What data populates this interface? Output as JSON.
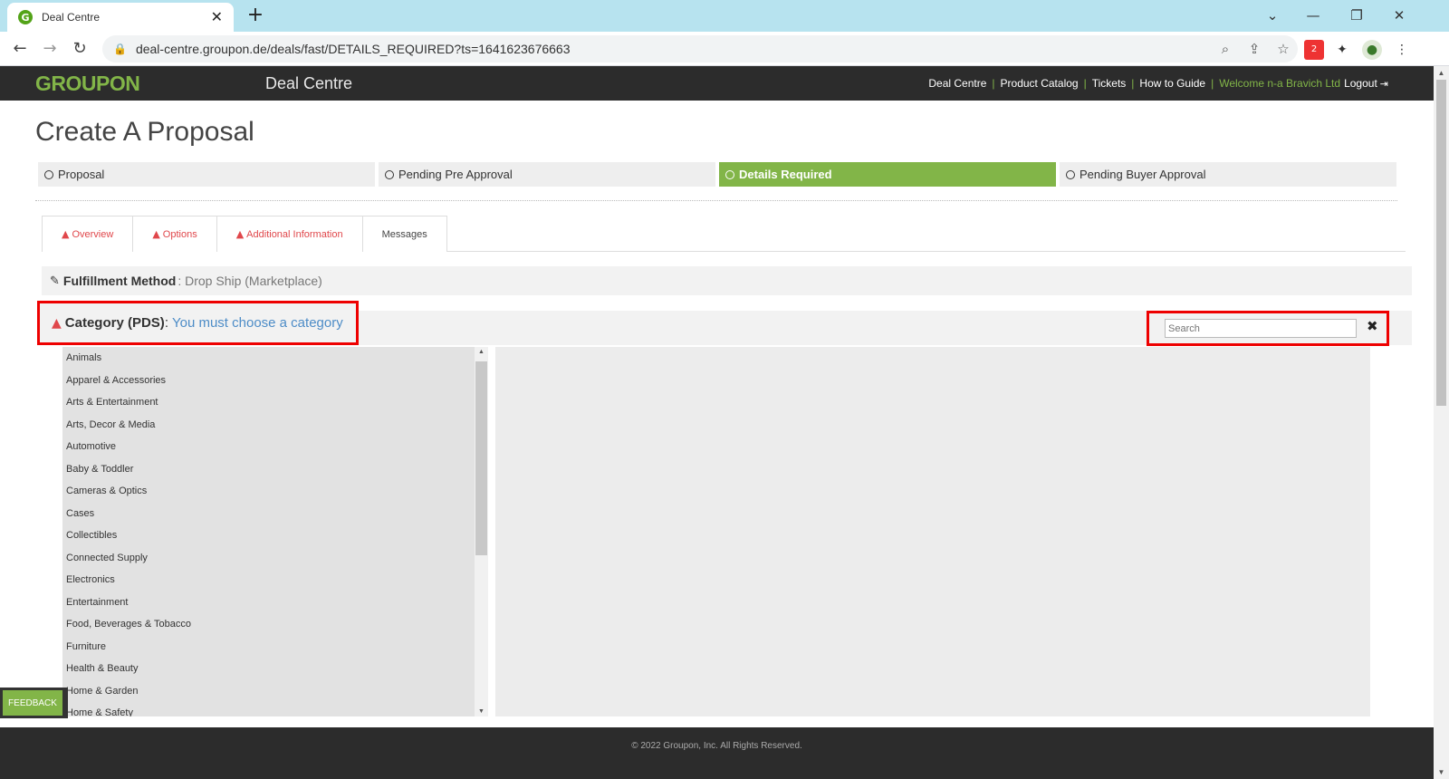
{
  "browser": {
    "tab_title": "Deal Centre",
    "tab_favicon": "G",
    "new_tab": "+",
    "url": "deal-centre.groupon.de/deals/fast/DETAILS_REQUIRED?ts=1641623676663",
    "extension_badge": "2"
  },
  "header": {
    "logo": "GROUPON",
    "app_name": "Deal Centre",
    "nav": [
      "Deal Centre",
      "Product Catalog",
      "Tickets",
      "How to Guide"
    ],
    "welcome": "Welcome n-a Bravich Ltd",
    "logout": "Logout"
  },
  "page": {
    "title": "Create A Proposal",
    "steps": [
      {
        "label": "Proposal",
        "active": false
      },
      {
        "label": "Pending Pre Approval",
        "active": false
      },
      {
        "label": "Details Required",
        "active": true
      },
      {
        "label": "Pending Buyer Approval",
        "active": false
      }
    ],
    "tabs": [
      {
        "label": "Overview",
        "warning": true
      },
      {
        "label": "Options",
        "warning": true
      },
      {
        "label": "Additional Information",
        "warning": true
      },
      {
        "label": "Messages",
        "warning": false
      }
    ],
    "fulfillment": {
      "label": "Fulfillment Method",
      "value": ": Drop Ship (Marketplace)"
    },
    "category": {
      "label": "Category (PDS)",
      "sep": ":",
      "message": "You must choose a category",
      "search_placeholder": "Search",
      "items": [
        "Animals",
        "Apparel & Accessories",
        "Arts & Entertainment",
        "Arts, Decor & Media",
        "Automotive",
        "Baby & Toddler",
        "Cameras & Optics",
        "Cases",
        "Collectibles",
        "Connected Supply",
        "Electronics",
        "Entertainment",
        "Food, Beverages & Tobacco",
        "Furniture",
        "Health & Beauty",
        "Home & Garden",
        "Home & Safety"
      ]
    },
    "feedback": "FEEDBACK",
    "footer": "© 2022 Groupon, Inc. All Rights Reserved."
  },
  "colors": {
    "brand_green": "#82b548",
    "header_dark": "#2c2c2c",
    "warning_red": "#e0474b",
    "link_blue": "#4d8cc7",
    "highlight_red": "#ee0000"
  }
}
